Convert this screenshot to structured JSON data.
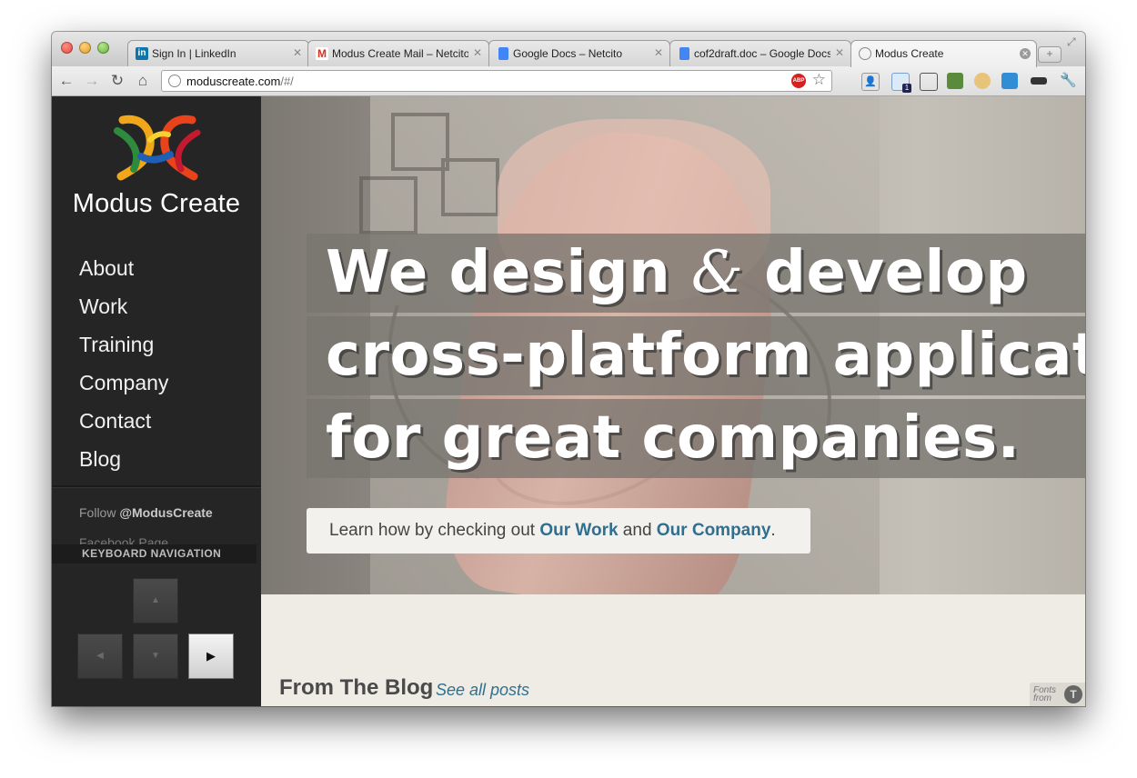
{
  "browser": {
    "tabs": [
      {
        "title": "Sign In | LinkedIn",
        "favicon": "linkedin-icon",
        "color": "#0e76a8"
      },
      {
        "title": "Modus Create Mail – Netcito",
        "favicon": "gmail-icon",
        "color": "#d93025"
      },
      {
        "title": "Google Docs – Netcito",
        "favicon": "google-docs-icon",
        "color": "#4285f4"
      },
      {
        "title": "cof2draft.doc – Google Docs",
        "favicon": "google-docs-icon",
        "color": "#4285f4"
      },
      {
        "title": "Modus Create",
        "favicon": "globe-icon",
        "color": "#888888"
      }
    ],
    "active_tab_index": 4,
    "url_host": "moduscreate.com",
    "url_path": "/#/",
    "abp_label": "ABP",
    "ext_badge": "1"
  },
  "site": {
    "brand": "Modus Create",
    "nav": [
      "About",
      "Work",
      "Training",
      "Company",
      "Contact",
      "Blog"
    ],
    "follow_prefix": "Follow ",
    "follow_handle": "@ModusCreate",
    "facebook": "Facebook Page",
    "keyboard_nav_label": "KEYBOARD NAVIGATION"
  },
  "hero": {
    "line1_a": "We design ",
    "line1_amp": "&",
    "line1_b": " develop",
    "line2": "cross-platform applications",
    "line3": "for great companies.",
    "learn_prefix": "Learn how by checking out ",
    "learn_link1": "Our Work",
    "learn_mid": " and ",
    "learn_link2": "Our Company",
    "learn_suffix": "."
  },
  "blog": {
    "heading": "From The Blog",
    "see_all": "See all posts"
  },
  "fonts_badge": {
    "line1": "Fonts",
    "line2": "from"
  },
  "colors": {
    "sidebar": "#252525",
    "link": "#2f6f8f",
    "page_bg": "#efece6"
  }
}
